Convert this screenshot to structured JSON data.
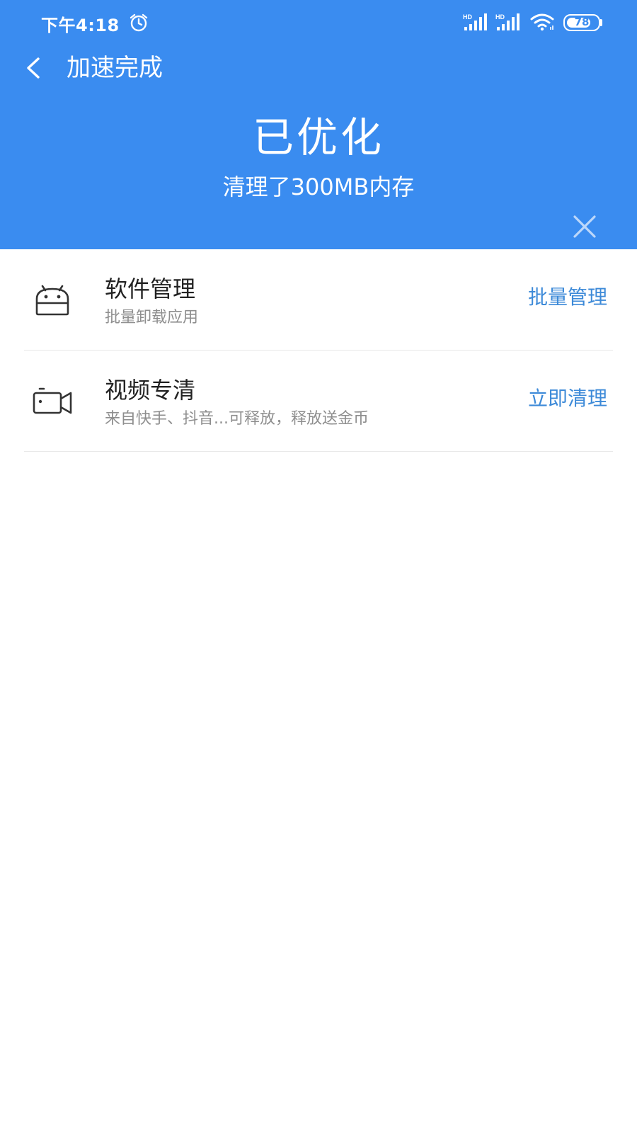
{
  "status_bar": {
    "time": "下午4:18",
    "alarm_icon": "alarm-icon",
    "signal_1_label": "HD",
    "signal_2_label": "HD",
    "wifi_icon": "wifi-icon",
    "battery_level": "78",
    "battery_percent": 78
  },
  "nav": {
    "back_icon": "chevron-left-icon",
    "title": "加速完成"
  },
  "result": {
    "headline": "已优化",
    "subline": "清理了300MB内存",
    "close_icon": "close-icon"
  },
  "list": {
    "items": [
      {
        "icon": "android-icon",
        "title": "软件管理",
        "subtitle": "批量卸载应用",
        "action": "批量管理"
      },
      {
        "icon": "video-camera-icon",
        "title": "视频专清",
        "subtitle": "来自快手、抖音...可释放，释放送金币",
        "action": "立即清理"
      }
    ]
  },
  "colors": {
    "header_background": "#3a8cf0",
    "action_text": "#3d8ad8",
    "title_text": "#222222",
    "subtitle_text": "#8e8e8e",
    "divider": "#e8e8e8"
  }
}
